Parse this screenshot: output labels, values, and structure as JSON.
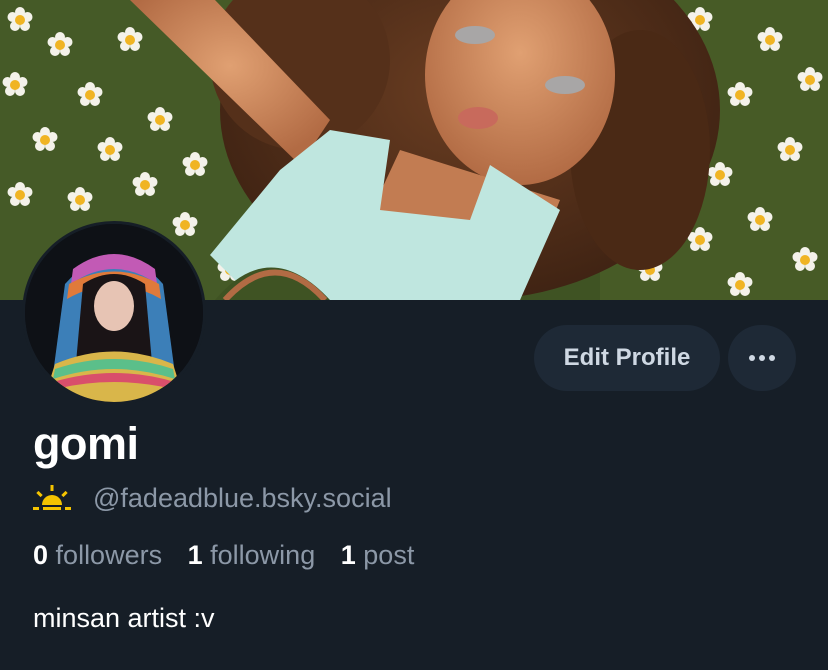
{
  "profile": {
    "display_name": "gomi",
    "handle": "@fadeadblue.bsky.social",
    "handle_icon": "sunrise-icon",
    "bio": "minsan artist :v"
  },
  "stats": {
    "followers_count": "0",
    "followers_label": "followers",
    "following_count": "1",
    "following_label": "following",
    "posts_count": "1",
    "posts_label": "post"
  },
  "actions": {
    "edit_profile_label": "Edit Profile",
    "more_label": "···"
  },
  "colors": {
    "background": "#161e27",
    "button_bg": "#1e2936",
    "muted_text": "#8c98a7",
    "primary_text": "#ffffff",
    "accent_sun": "#f5c400"
  }
}
